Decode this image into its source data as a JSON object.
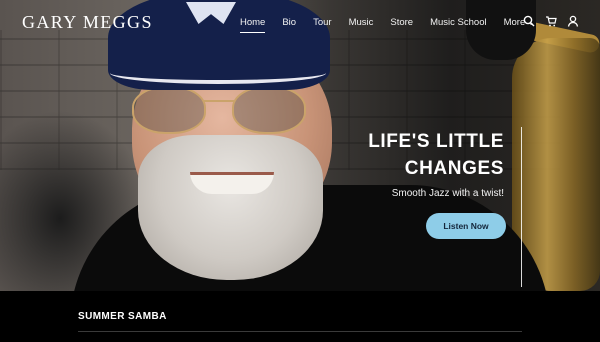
{
  "header": {
    "logo": "GARY MEGGS",
    "nav": [
      {
        "label": "Home",
        "active": true
      },
      {
        "label": "Bio",
        "active": false
      },
      {
        "label": "Tour",
        "active": false
      },
      {
        "label": "Music",
        "active": false
      },
      {
        "label": "Store",
        "active": false
      },
      {
        "label": "Music School",
        "active": false
      },
      {
        "label": "More",
        "active": false,
        "icon": "chevron-down-icon"
      }
    ],
    "icons": [
      "search-icon",
      "cart-icon",
      "user-icon"
    ]
  },
  "hero": {
    "headline_line1": "LIFE'S LITTLE",
    "headline_line2": "CHANGES",
    "subtitle": "Smooth Jazz with a twist!",
    "cta_label": "Listen Now",
    "cta_color": "#8ecde8"
  },
  "section": {
    "title": "SUMMER SAMBA"
  }
}
